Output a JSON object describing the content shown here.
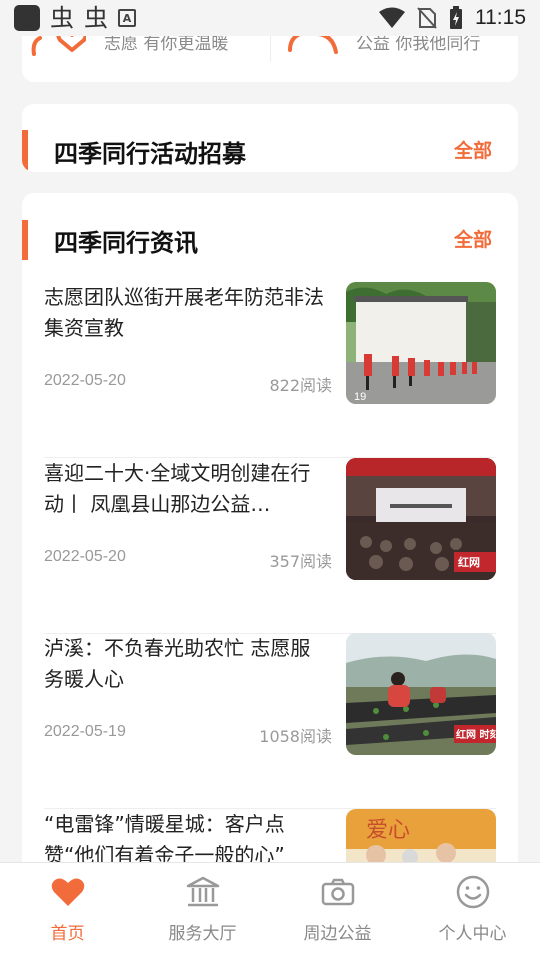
{
  "status_bar": {
    "time": "11:15",
    "app_glyph": "虫"
  },
  "top_card": {
    "left_text": "志愿 有你更温暖",
    "right_text": "公益 你我他同行"
  },
  "recruit": {
    "title": "四季同行活动招募",
    "more": "全部"
  },
  "news": {
    "title": "四季同行资讯",
    "more": "全部",
    "items": [
      {
        "title": "志愿团队巡街开展老年防范非法集资宣教",
        "date": "2022-05-20",
        "reads": "822阅读",
        "thumb_overlay": "19"
      },
      {
        "title": "喜迎二十大·全域文明创建在行动丨 凤凰县山那边公益…",
        "date": "2022-05-20",
        "reads": "357阅读",
        "thumb_overlay": "红网"
      },
      {
        "title": "泸溪：不负春光助农忙 志愿服务暖人心",
        "date": "2022-05-19",
        "reads": "1058阅读",
        "thumb_overlay": "红网 时刻"
      },
      {
        "title": "“电雷锋”情暖星城：客户点赞“他们有着金子一般的心”",
        "date": "",
        "reads": "",
        "thumb_overlay": ""
      }
    ]
  },
  "bottom_nav": {
    "items": [
      {
        "label": "首页",
        "icon": "heart-icon",
        "active": true
      },
      {
        "label": "服务大厅",
        "icon": "institution-icon",
        "active": false
      },
      {
        "label": "周边公益",
        "icon": "camera-icon",
        "active": false
      },
      {
        "label": "个人中心",
        "icon": "smile-icon",
        "active": false
      }
    ]
  },
  "colors": {
    "accent": "#f26b3a",
    "background": "#f4f4f4"
  }
}
